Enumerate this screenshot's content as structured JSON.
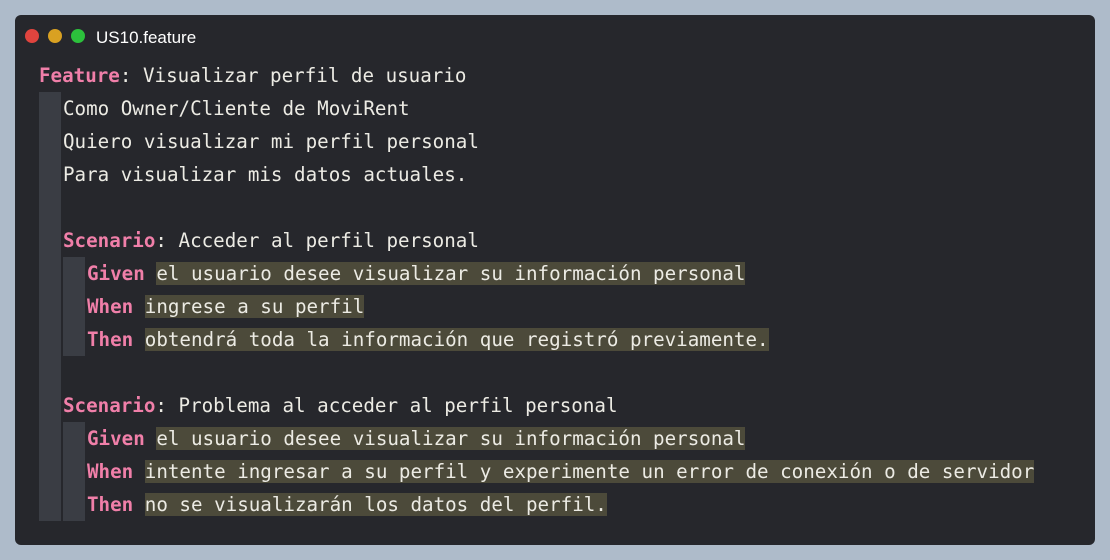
{
  "window": {
    "title": "US10.feature",
    "controls": [
      "close",
      "minimize",
      "maximize"
    ]
  },
  "feature": {
    "keyword": "Feature",
    "name": "Visualizar perfil de usuario",
    "description": [
      "Como Owner/Cliente de MoviRent",
      "Quiero visualizar mi perfil personal",
      "Para visualizar mis datos actuales."
    ]
  },
  "scenarios": [
    {
      "keyword": "Scenario",
      "name": "Acceder al perfil personal",
      "steps": [
        {
          "keyword": "Given",
          "text": "el usuario desee visualizar su información personal"
        },
        {
          "keyword": "When",
          "text": "ingrese a su perfil"
        },
        {
          "keyword": "Then",
          "text": "obtendrá toda la información que registró previamente."
        }
      ]
    },
    {
      "keyword": "Scenario",
      "name": "Problema al acceder al perfil personal",
      "steps": [
        {
          "keyword": "Given",
          "text": "el usuario desee visualizar su información personal"
        },
        {
          "keyword": "When",
          "text": "intente ingresar a su perfil y experimente un error de conexión o de servidor"
        },
        {
          "keyword": "Then",
          "text": "no se visualizarán los datos del perfil."
        }
      ]
    }
  ],
  "colors": {
    "keyword": "#f07fa9",
    "text": "#ecebe4",
    "background": "#26272c",
    "highlight": "#4c4a3a",
    "indent_guide": "#3a3d44"
  }
}
